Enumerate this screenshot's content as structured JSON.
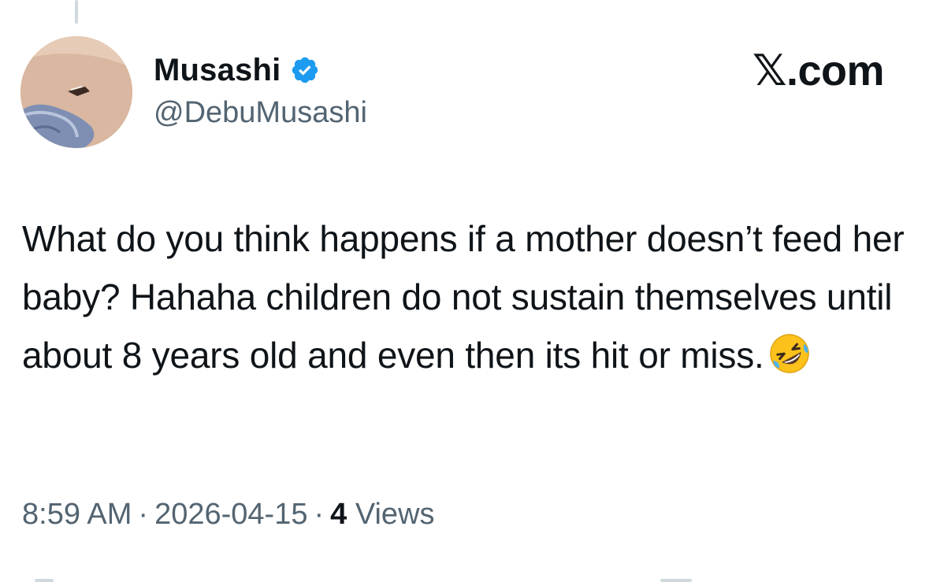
{
  "author": {
    "display_name": "Musashi",
    "handle": "@DebuMusashi",
    "verified": true,
    "verified_color": "#1d9bf0"
  },
  "brand": {
    "logo_text": "𝕏.com"
  },
  "tweet": {
    "text": "What do you think happens if a mother doesn’t feed her baby? Hahaha children do not sustain themselves until about 8 years old and even then its hit or miss.",
    "emoji_icon": "rolling-on-floor-laughing-emoji"
  },
  "meta": {
    "time": "8:59 AM",
    "separator": "·",
    "date": "2026-04-15",
    "views_count": "4",
    "views_label": "Views"
  },
  "colors": {
    "text_primary": "#0f1419",
    "text_secondary": "#536471",
    "divider": "#cfd9de"
  }
}
